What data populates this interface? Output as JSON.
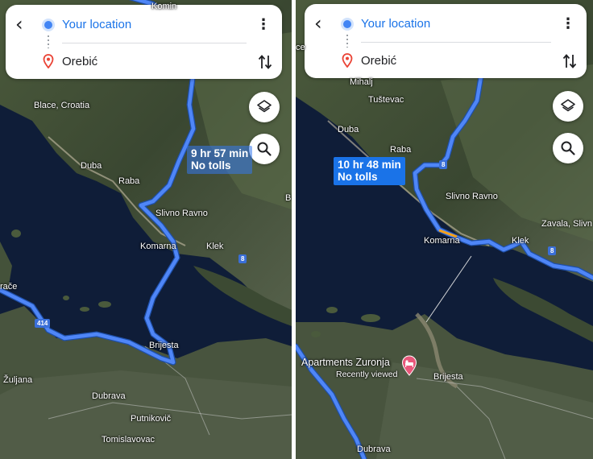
{
  "colors": {
    "route": "#4f86f7",
    "route_outline": "#1e4fa8",
    "accent_blue": "#1a73e8",
    "sea": "#0e1b36",
    "land": "#3e4b34"
  },
  "screens": [
    {
      "directions_card": {
        "origin": "Your location",
        "destination": "Orebić",
        "back_icon": "arrow-back-icon",
        "more_icon": "more-vert-icon",
        "swap_icon": "swap-vert-icon"
      },
      "map_buttons": {
        "layers_icon": "layers-icon",
        "search_icon": "search-icon"
      },
      "route_callout": {
        "duration": "9 hr 57 min",
        "note": "No tolls"
      },
      "road_shields": [
        "8",
        "414"
      ],
      "place_labels": [
        "Komin",
        "Blace, Croatia",
        "Duba",
        "Raba",
        "Slivno Ravno",
        "Komarna",
        "Klek",
        "Brijesta",
        "Žuljana",
        "Dubrava",
        "Putnikovič",
        "Tomislavovac",
        "B",
        "rače"
      ]
    },
    {
      "directions_card": {
        "origin": "Your location",
        "destination": "Orebić",
        "back_icon": "arrow-back-icon",
        "more_icon": "more-vert-icon",
        "swap_icon": "swap-vert-icon"
      },
      "map_buttons": {
        "layers_icon": "layers-icon",
        "search_icon": "search-icon"
      },
      "route_callout": {
        "duration": "10 hr 48 min",
        "note": "No tolls"
      },
      "road_shields": [
        "8",
        "8"
      ],
      "place_labels": [
        "Mihalj",
        "Tuštevac",
        "Duba",
        "Raba",
        "Slivno Ravno",
        "Komarna",
        "Klek",
        "Zavala, Slivn",
        "Brijesta",
        "Dubrava",
        "ce"
      ],
      "poi": {
        "name": "Apartments Zuronja",
        "subtitle": "Recently viewed",
        "icon": "bed-pin-icon"
      }
    }
  ]
}
